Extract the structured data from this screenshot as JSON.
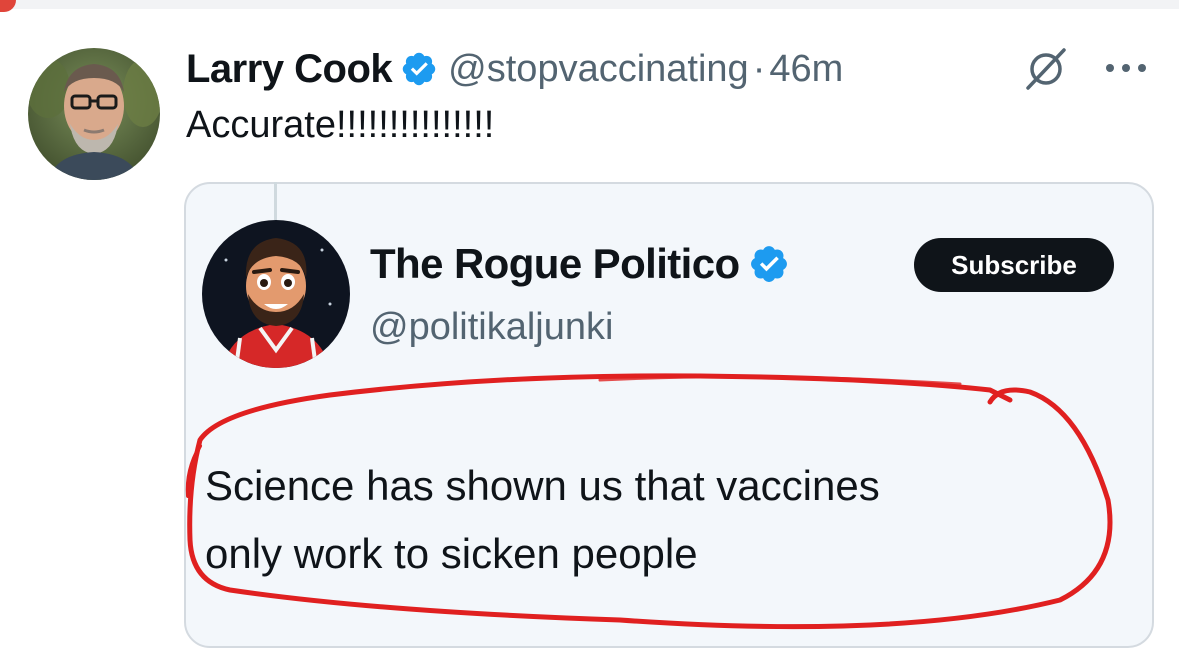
{
  "tweet": {
    "author": {
      "display_name": "Larry Cook",
      "handle": "@stopvaccinating",
      "verified": true
    },
    "separator": "·",
    "timestamp": "46m",
    "text": "Accurate!!!!!!!!!!!!!!!"
  },
  "quoted_tweet": {
    "author": {
      "display_name": "The Rogue Politico",
      "handle": "@politikaljunki",
      "verified": true
    },
    "subscribe_label": "Subscribe",
    "lines": [
      "Science has shown us that vaccines",
      "only work to sicken people"
    ]
  },
  "icons": {
    "verified_badge": "verified-badge-icon",
    "grok": "grok-icon",
    "more": "more-options-icon"
  },
  "colors": {
    "verified_blue": "#1d9bf0",
    "secondary_text": "#536471",
    "annotation_red": "#e02020",
    "button_dark": "#0f1419"
  }
}
